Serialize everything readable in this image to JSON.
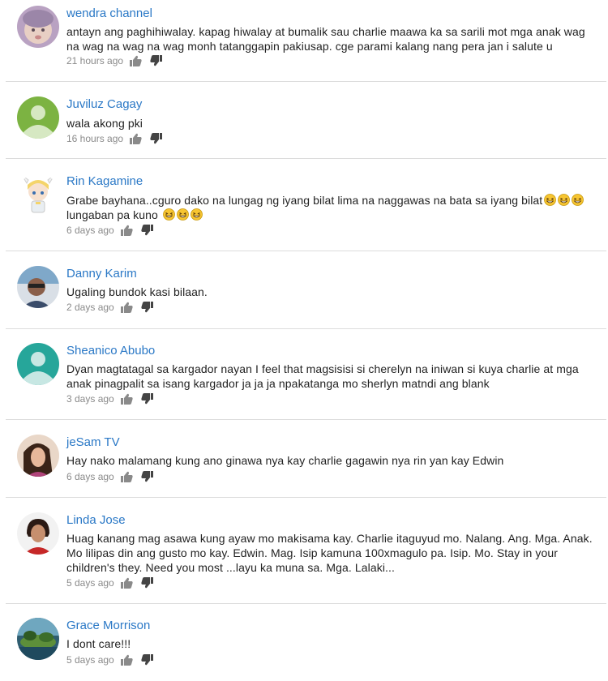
{
  "comments": [
    {
      "author": "wendra channel",
      "text": "antayn ang paghihiwalay. kapag hiwalay at bumalik sau charlie maawa ka sa sarili mot mga anak wag na wag na wag na wag monh tatanggapin pakiusap. cge parami kalang nang pera jan i salute u",
      "time": "21 hours ago",
      "avatar": "baby-photo-avatar"
    },
    {
      "author": "Juviluz Cagay",
      "text": "wala akong pki",
      "time": "16 hours ago",
      "avatar": "default-green-avatar"
    },
    {
      "author": "Rin Kagamine",
      "text": "Grabe bayhana..cguro dako na lungag ng iyang bilat lima na naggawas na bata sa iyang bilat",
      "text_cont": "lungaban pa kuno",
      "time": "6 days ago",
      "avatar": "anime-character-avatar",
      "emoji": "grinning-squinting-face"
    },
    {
      "author": "Danny Karim",
      "text": "Ugaling bundok kasi bilaan.",
      "time": "2 days ago",
      "avatar": "person-photo-avatar"
    },
    {
      "author": "Sheanico Abubo",
      "text": "Dyan magtatagal sa kargador nayan I feel that magsisisi si cherelyn na iniwan si kuya charlie at mga anak pinagpalit sa isang kargador ja ja ja npakatanga mo sherlyn matndi ang blank",
      "time": "3 days ago",
      "avatar": "default-teal-avatar"
    },
    {
      "author": "jeSam TV",
      "text": "Hay nako malamang kung ano ginawa nya kay charlie gagawin nya rin yan kay Edwin",
      "time": "6 days ago",
      "avatar": "person-photo-avatar"
    },
    {
      "author": "Linda Jose",
      "text": "Huag kanang mag asawa kung ayaw mo makisama kay. Charlie  itaguyud mo. Nalang. Ang. Mga. Anak. Mo  lilipas din ang gusto mo kay. Edwin.  Mag. Isip kamuna 100xmagulo pa. Isip. Mo. Stay in your children's they. Need you most ...layu ka muna sa. Mga. Lalaki...",
      "time": "5 days ago",
      "avatar": "person-photo-avatar"
    },
    {
      "author": "Grace Morrison",
      "text": "I dont care!!!",
      "time": "5 days ago",
      "avatar": "landscape-photo-avatar"
    }
  ]
}
